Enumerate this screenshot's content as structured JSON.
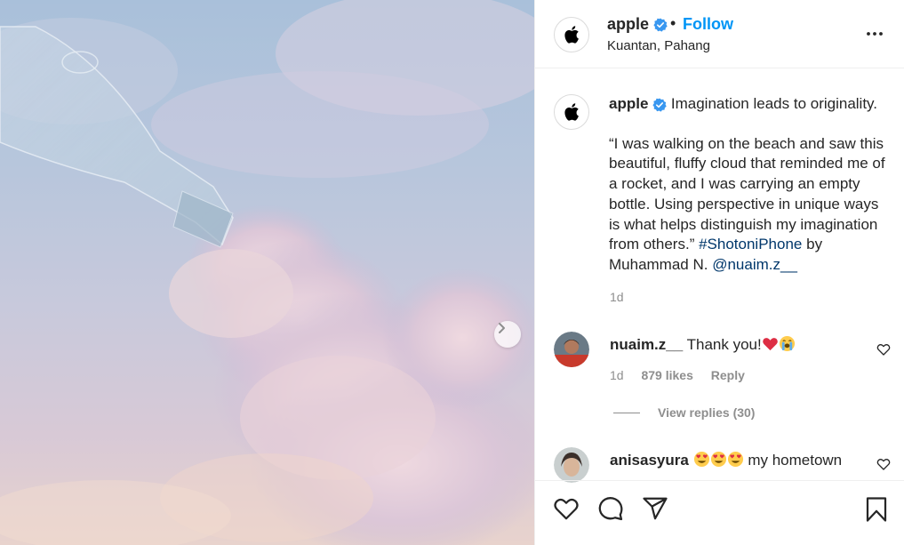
{
  "post": {
    "username": "apple",
    "follow_label": "Follow",
    "separator": "•",
    "location": "Kuantan, Pahang"
  },
  "caption": {
    "username": "apple",
    "lead": "Imagination leads to originality.",
    "quote": "“I was walking on the beach and saw this beautiful, fluffy cloud that reminded me of a rocket, and I was carrying an empty bottle. Using perspective in unique ways is what helps distinguish my imagination from others.”",
    "hashtag": "#ShotoniPhone",
    "by": "by Muhammad N.",
    "mention": "@nuaim.z__",
    "time": "1d"
  },
  "comments": [
    {
      "username": "nuaim.z__",
      "text": "Thank you!",
      "emojis": [
        "red-heart",
        "loudly-crying-face"
      ],
      "time": "1d",
      "likes": "879 likes",
      "reply_label": "Reply",
      "view_replies": "View replies (30)"
    },
    {
      "username": "anisasyura",
      "emojis": [
        "heart-eyes-face",
        "heart-eyes-face",
        "heart-eyes-face"
      ],
      "text": "my hometown"
    }
  ],
  "icons": {
    "more": "more-options-icon",
    "next": "chevron-right-icon",
    "like": "heart-icon",
    "comment": "comment-icon",
    "share": "share-icon",
    "save": "bookmark-icon",
    "verified": "verified-badge-icon",
    "brand": "apple-logo-icon"
  },
  "colors": {
    "link_blue": "#0095f6",
    "hashtag": "#00376b",
    "verified": "#3897f0",
    "muted": "#8e8e8e"
  }
}
